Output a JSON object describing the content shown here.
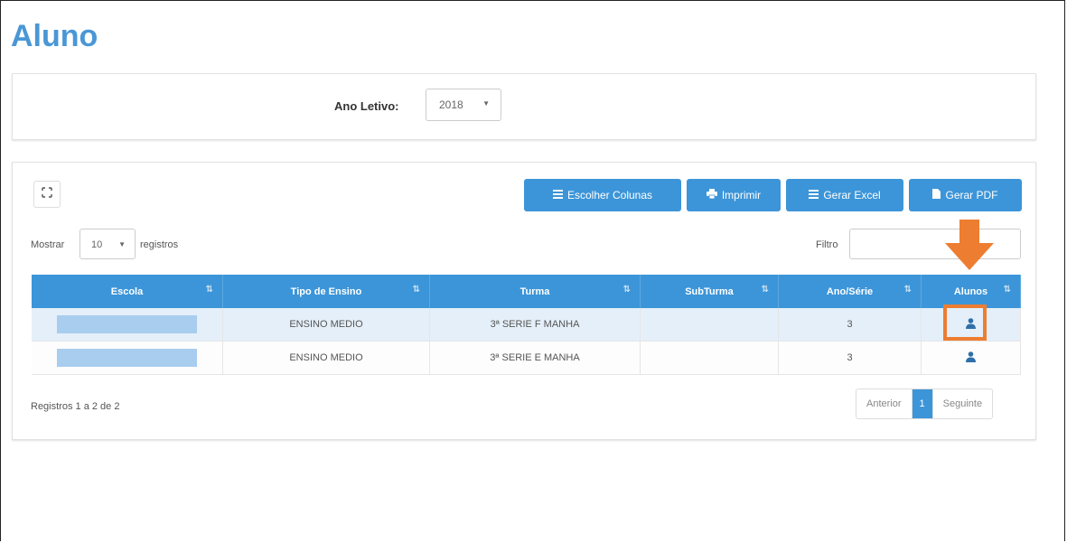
{
  "page": {
    "title": "Aluno"
  },
  "year_filter": {
    "label": "Ano Letivo:",
    "selected": "2018"
  },
  "toolbar": {
    "choose_columns": "Escolher Colunas",
    "print": "Imprimir",
    "excel": "Gerar Excel",
    "pdf": "Gerar PDF"
  },
  "length_menu": {
    "before": "Mostrar",
    "selected": "10",
    "after": "registros"
  },
  "search": {
    "label": "Filtro",
    "value": ""
  },
  "table": {
    "headers": [
      "Escola",
      "Tipo de Ensino",
      "Turma",
      "SubTurma",
      "Ano/Série",
      "Alunos"
    ],
    "rows": [
      {
        "escola": "",
        "tipo": "ENSINO MEDIO",
        "turma": "3ª SERIE F MANHA",
        "subturma": "",
        "ano": "3"
      },
      {
        "escola": "",
        "tipo": "ENSINO MEDIO",
        "turma": "3ª SERIE E MANHA",
        "subturma": "",
        "ano": "3"
      }
    ]
  },
  "footer": {
    "info": "Registros 1 a 2 de 2"
  },
  "pagination": {
    "prev": "Anterior",
    "current": "1",
    "next": "Seguinte"
  },
  "colors": {
    "accent": "#3c95d8",
    "title": "#4a97d6",
    "callout": "#ed7d31",
    "selected_row": "#e4eff9"
  },
  "icons": {
    "expand": "expand-icon",
    "columns": "list-icon",
    "print": "print-icon",
    "excel": "list-icon",
    "pdf": "file-icon",
    "sort": "sort-icon",
    "students": "user-icon",
    "callout": "arrow-down-icon"
  }
}
